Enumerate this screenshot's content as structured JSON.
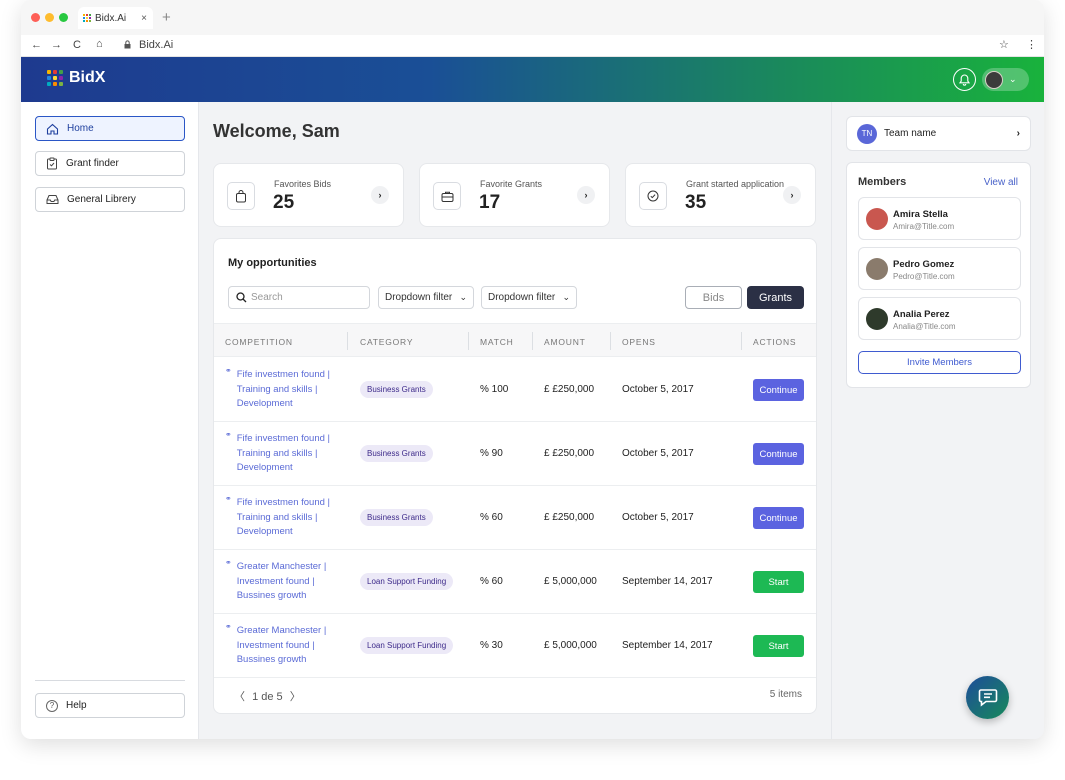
{
  "browser": {
    "tab_title": "Bidx.Ai",
    "tab_close": "×",
    "new_tab": "+",
    "url": "Bidx.Ai",
    "nav_back": "←",
    "nav_forward": "→",
    "nav_reload": "C",
    "nav_home": "⌂",
    "star": "☆",
    "menu": "⋮"
  },
  "brand": {
    "name": "BidX",
    "logo_colors": [
      "#f5b400",
      "#e53935",
      "#43a047",
      "#1e88e5",
      "#fdd835",
      "#8e24aa",
      "#00acc1",
      "#fb8c00",
      "#7cb342"
    ]
  },
  "sidebar": {
    "items": [
      {
        "label": "Home",
        "icon": "home-icon",
        "active": true
      },
      {
        "label": "Grant finder",
        "icon": "clipboard-icon",
        "active": false
      },
      {
        "label": "General Librery",
        "icon": "inbox-icon",
        "active": false
      }
    ],
    "help_label": "Help",
    "help_icon": "?"
  },
  "main": {
    "welcome": "Welcome, Sam",
    "stats": [
      {
        "label": "Favorites Bids",
        "value": "25",
        "icon": "bag-icon",
        "arrow": "›"
      },
      {
        "label": "Favorite Grants",
        "value": "17",
        "icon": "briefcase-icon",
        "arrow": "›"
      },
      {
        "label": "Grant started application",
        "value": "35",
        "icon": "check-circle-icon",
        "arrow": "›"
      }
    ],
    "opportunities": {
      "title": "My opportunities",
      "search_placeholder": "Search",
      "filters": [
        "Dropdown filter",
        "Dropdown filter"
      ],
      "filter_chevron": "⌄",
      "toggle": {
        "bids": "Bids",
        "grants": "Grants",
        "selected": "Grants"
      },
      "columns": [
        "COMPETITION",
        "CATEGORY",
        "MATCH",
        "AMOUNT",
        "OPENS",
        "ACTIONS"
      ],
      "rows": [
        {
          "competition": "Fife investmen found | Training and skills | Development",
          "category": "Business Grants",
          "match": "% 100",
          "amount": "£ £250,000",
          "opens": "October 5, 2017",
          "action": "Continue",
          "action_color": "#5b63e0"
        },
        {
          "competition": "Fife investmen found | Training and skills | Development",
          "category": "Business Grants",
          "match": "% 90",
          "amount": "£ £250,000",
          "opens": "October 5, 2017",
          "action": "Continue",
          "action_color": "#5b63e0"
        },
        {
          "competition": "Fife investmen found | Training and skills | Development",
          "category": "Business Grants",
          "match": "% 60",
          "amount": "£ £250,000",
          "opens": "October 5, 2017",
          "action": "Continue",
          "action_color": "#5b63e0"
        },
        {
          "competition": "Greater Manchester | Investment found | Bussines growth",
          "category": "Loan Support Funding",
          "match": "% 60",
          "amount": "£ 5,000,000",
          "opens": "September 14, 2017",
          "action": "Start",
          "action_color": "#1db954"
        },
        {
          "competition": "Greater Manchester | Investment found | Bussines growth",
          "category": "Loan Support Funding",
          "match": "% 30",
          "amount": "£ 5,000,000",
          "opens": "September 14, 2017",
          "action": "Start",
          "action_color": "#1db954"
        }
      ],
      "pager": {
        "prev": "〈",
        "text": "1 de 5",
        "next": "〉"
      },
      "items_count": "5 items"
    }
  },
  "right_panel": {
    "team": {
      "initials": "TN",
      "name": "Team name",
      "chevron": "›"
    },
    "members_title": "Members",
    "view_all": "View all",
    "members": [
      {
        "name": "Amira Stella",
        "email": "Amira@Title.com",
        "avatar_color": "#c9574f"
      },
      {
        "name": "Pedro Gomez",
        "email": "Pedro@Title.com",
        "avatar_color": "#8a7b6c"
      },
      {
        "name": "Analia Perez",
        "email": "Analia@Title.com",
        "avatar_color": "#2e3a2b"
      }
    ],
    "invite_label": "Invite Members"
  },
  "header": {
    "user_chevron": "⌄"
  }
}
